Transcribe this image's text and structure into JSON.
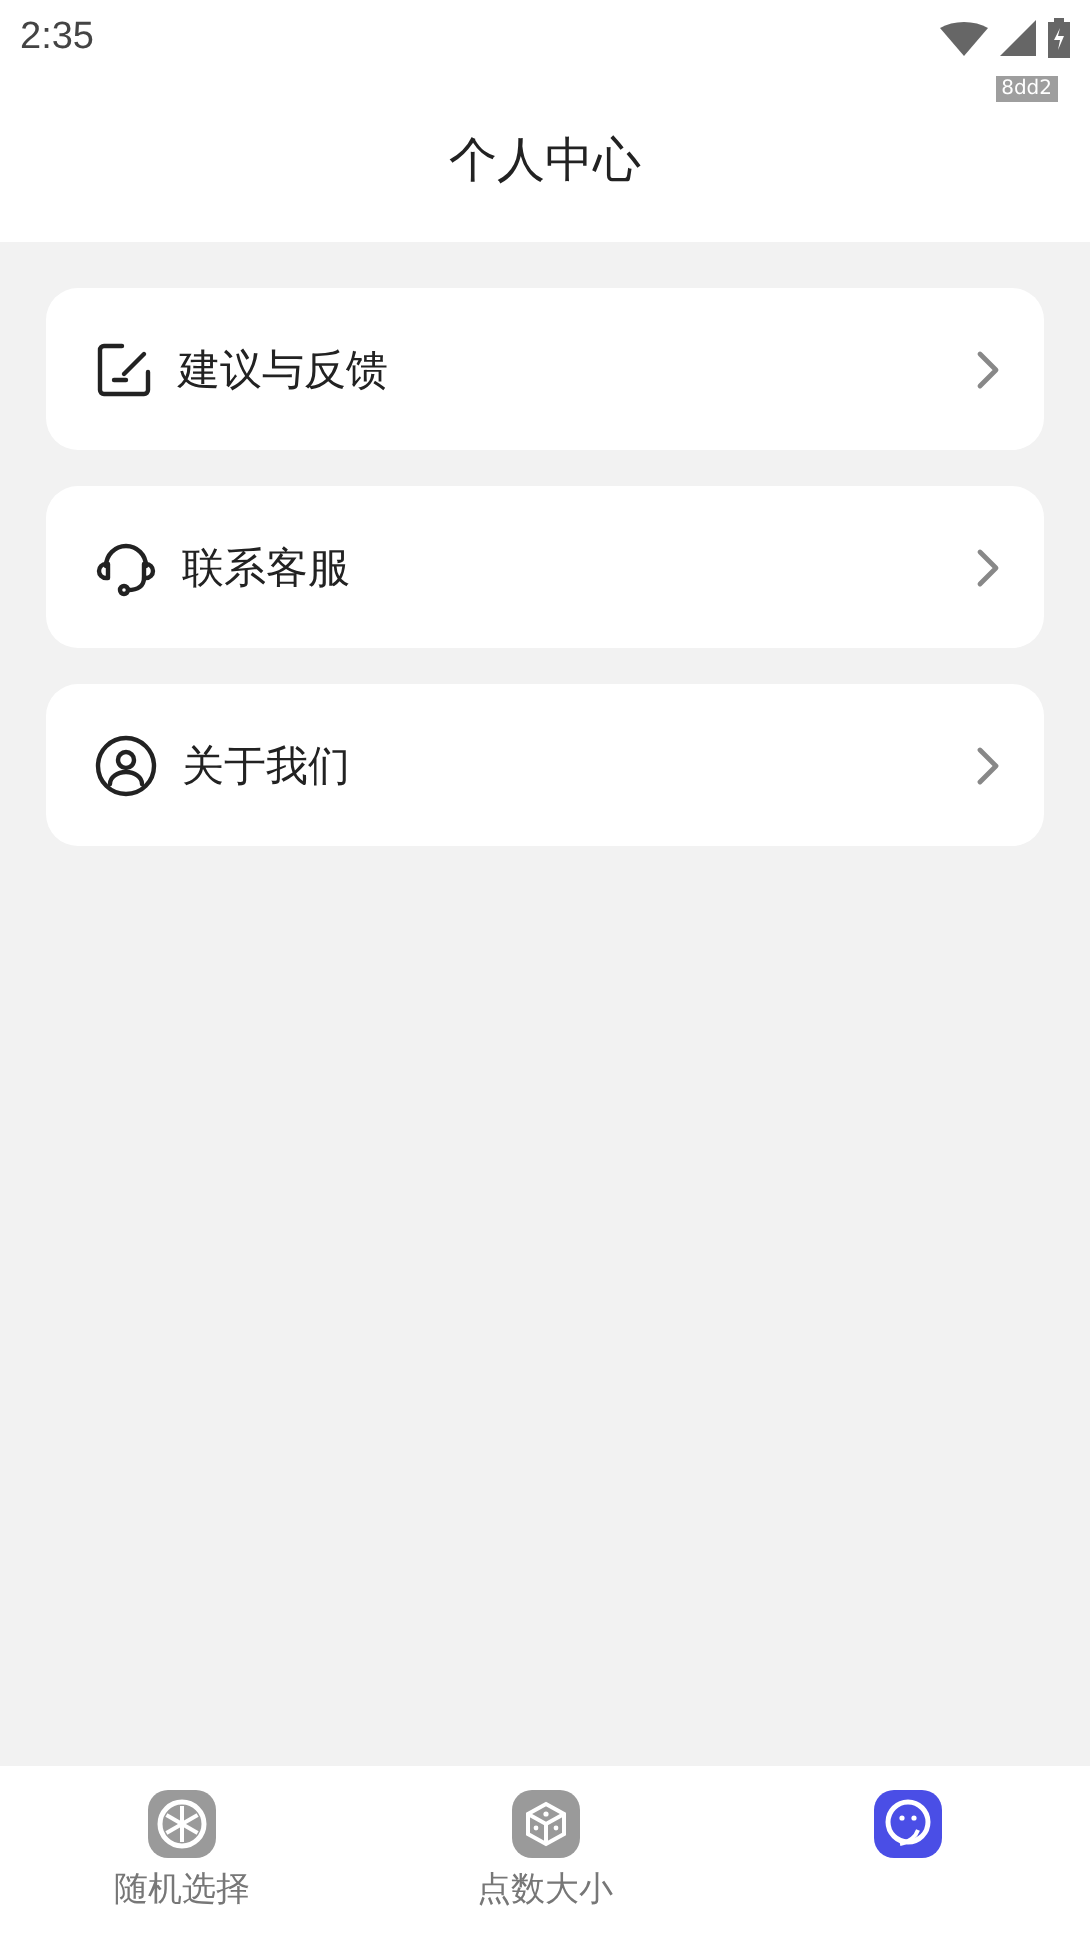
{
  "status_bar": {
    "time": "2:35",
    "tag": "8dd2"
  },
  "header": {
    "title": "个人中心"
  },
  "menu": [
    {
      "kind": "feedback",
      "label": "建议与反馈"
    },
    {
      "kind": "support",
      "label": "联系客服"
    },
    {
      "kind": "about",
      "label": "关于我们"
    }
  ],
  "bottom_nav": [
    {
      "kind": "wheel",
      "label": "随机选择",
      "selected": false
    },
    {
      "kind": "dice",
      "label": "点数大小",
      "selected": false
    },
    {
      "kind": "profile",
      "selected": true
    }
  ]
}
